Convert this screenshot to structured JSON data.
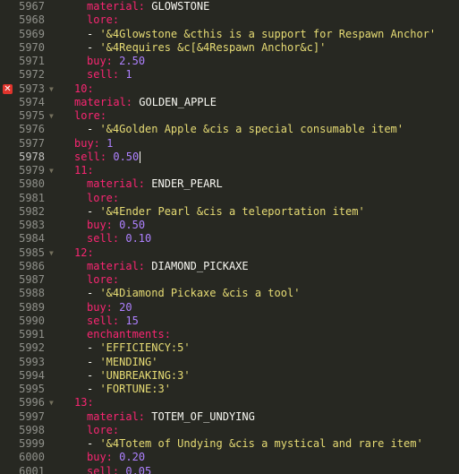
{
  "editor": {
    "lines": [
      {
        "n": "5967",
        "indent": 2,
        "t": "kv",
        "k": "material:",
        "v": "GLOWSTONE",
        "vt": "plain"
      },
      {
        "n": "5968",
        "indent": 2,
        "t": "k",
        "k": "lore:"
      },
      {
        "n": "5969",
        "indent": 2,
        "t": "li",
        "v": "'&4Glowstone &cthis is a support for Respawn Anchor'"
      },
      {
        "n": "5970",
        "indent": 2,
        "t": "li",
        "v": "'&4Requires &c[&4Respawn Anchor&c]'"
      },
      {
        "n": "5971",
        "indent": 2,
        "t": "kv",
        "k": "buy:",
        "v": "2.50",
        "vt": "num"
      },
      {
        "n": "5972",
        "indent": 2,
        "t": "kv",
        "k": "sell:",
        "v": "1",
        "vt": "num"
      },
      {
        "n": "5973",
        "indent": 1,
        "t": "k",
        "k": "10:",
        "fold": true,
        "error": true
      },
      {
        "n": "5974",
        "indent": 1,
        "t": "kv",
        "k": "material:",
        "v": "GOLDEN_APPLE",
        "vt": "plain"
      },
      {
        "n": "5975",
        "indent": 1,
        "t": "k",
        "k": "lore:",
        "fold": true
      },
      {
        "n": "5976",
        "indent": 2,
        "t": "li",
        "v": "'&4Golden Apple &cis a special consumable item'"
      },
      {
        "n": "5977",
        "indent": 1,
        "t": "kv",
        "k": "buy:",
        "v": "1",
        "vt": "num"
      },
      {
        "n": "5978",
        "indent": 1,
        "t": "kv",
        "k": "sell:",
        "v": "0.50",
        "vt": "num",
        "caret": true,
        "active": true
      },
      {
        "n": "5979",
        "indent": 1,
        "t": "k",
        "k": "11:",
        "fold": true
      },
      {
        "n": "5980",
        "indent": 2,
        "t": "kv",
        "k": "material:",
        "v": "ENDER_PEARL",
        "vt": "plain"
      },
      {
        "n": "5981",
        "indent": 2,
        "t": "k",
        "k": "lore:"
      },
      {
        "n": "5982",
        "indent": 2,
        "t": "li",
        "v": "'&4Ender Pearl &cis a teleportation item'"
      },
      {
        "n": "5983",
        "indent": 2,
        "t": "kv",
        "k": "buy:",
        "v": "0.50",
        "vt": "num"
      },
      {
        "n": "5984",
        "indent": 2,
        "t": "kv",
        "k": "sell:",
        "v": "0.10",
        "vt": "num"
      },
      {
        "n": "5985",
        "indent": 1,
        "t": "k",
        "k": "12:",
        "fold": true
      },
      {
        "n": "5986",
        "indent": 2,
        "t": "kv",
        "k": "material:",
        "v": "DIAMOND_PICKAXE",
        "vt": "plain"
      },
      {
        "n": "5987",
        "indent": 2,
        "t": "k",
        "k": "lore:"
      },
      {
        "n": "5988",
        "indent": 2,
        "t": "li",
        "v": "'&4Diamond Pickaxe &cis a tool'"
      },
      {
        "n": "5989",
        "indent": 2,
        "t": "kv",
        "k": "buy:",
        "v": "20",
        "vt": "num"
      },
      {
        "n": "5990",
        "indent": 2,
        "t": "kv",
        "k": "sell:",
        "v": "15",
        "vt": "num"
      },
      {
        "n": "5991",
        "indent": 2,
        "t": "k",
        "k": "enchantments:"
      },
      {
        "n": "5992",
        "indent": 2,
        "t": "li",
        "v": "'EFFICIENCY:5'"
      },
      {
        "n": "5993",
        "indent": 2,
        "t": "li",
        "v": "'MENDING'"
      },
      {
        "n": "5994",
        "indent": 2,
        "t": "li",
        "v": "'UNBREAKING:3'"
      },
      {
        "n": "5995",
        "indent": 2,
        "t": "li",
        "v": "'FORTUNE:3'"
      },
      {
        "n": "5996",
        "indent": 1,
        "t": "k",
        "k": "13:",
        "fold": true
      },
      {
        "n": "5997",
        "indent": 2,
        "t": "kv",
        "k": "material:",
        "v": "TOTEM_OF_UNDYING",
        "vt": "plain"
      },
      {
        "n": "5998",
        "indent": 2,
        "t": "k",
        "k": "lore:"
      },
      {
        "n": "5999",
        "indent": 2,
        "t": "li",
        "v": "'&4Totem of Undying &cis a mystical and rare item'"
      },
      {
        "n": "6000",
        "indent": 2,
        "t": "kv",
        "k": "buy:",
        "v": "0.20",
        "vt": "num"
      },
      {
        "n": "6001",
        "indent": 2,
        "t": "kv",
        "k": "sell:",
        "v": "0.05",
        "vt": "num"
      }
    ],
    "error_icon_glyph": "✕",
    "fold_glyph": "▼"
  }
}
